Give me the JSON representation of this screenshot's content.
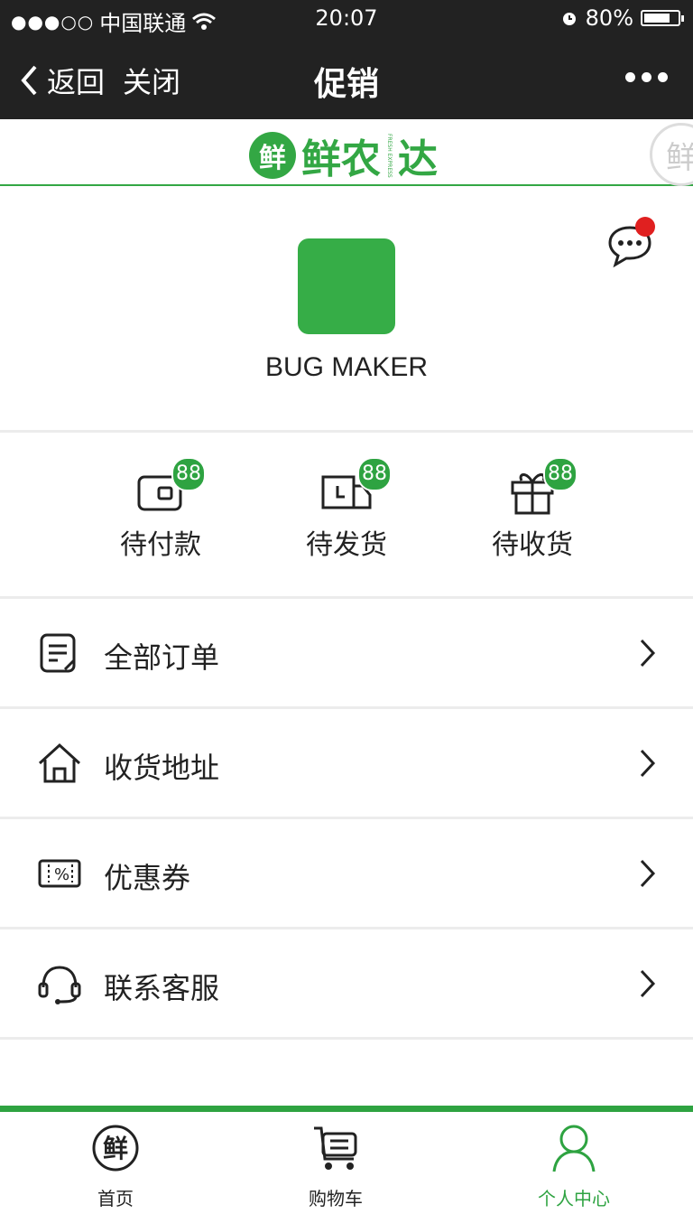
{
  "status_bar": {
    "signal": "●●●○○",
    "carrier": "中国联通",
    "time": "20:07",
    "battery": "80%",
    "battery_level": 0.8
  },
  "nav": {
    "back_label": "返回",
    "close_label": "关闭",
    "title": "促销"
  },
  "brand": {
    "mark": "鲜",
    "name_part1": "鲜农",
    "name_part2": "达",
    "tagline": "FRESH EXPRESS"
  },
  "profile": {
    "username": "BUG MAKER",
    "avatar_color": "#36ad47",
    "has_unread_messages": true
  },
  "order_status": [
    {
      "label": "待付款",
      "badge": "88",
      "icon": "wallet-icon"
    },
    {
      "label": "待发货",
      "badge": "88",
      "icon": "delivery-truck-icon"
    },
    {
      "label": "待收货",
      "badge": "88",
      "icon": "gift-box-icon"
    }
  ],
  "menu": [
    {
      "label": "全部订单",
      "icon": "order-list-icon"
    },
    {
      "label": "收货地址",
      "icon": "home-address-icon"
    },
    {
      "label": "优惠券",
      "icon": "coupon-icon"
    },
    {
      "label": "联系客服",
      "icon": "headset-icon"
    }
  ],
  "tabs": [
    {
      "label": "首页",
      "icon": "home-logo-icon",
      "active": false
    },
    {
      "label": "购物车",
      "icon": "cart-icon",
      "active": false
    },
    {
      "label": "个人中心",
      "icon": "user-icon",
      "active": true
    }
  ],
  "colors": {
    "brand_green": "#33a744",
    "header_dark": "#222222",
    "notification_red": "#e02020"
  }
}
